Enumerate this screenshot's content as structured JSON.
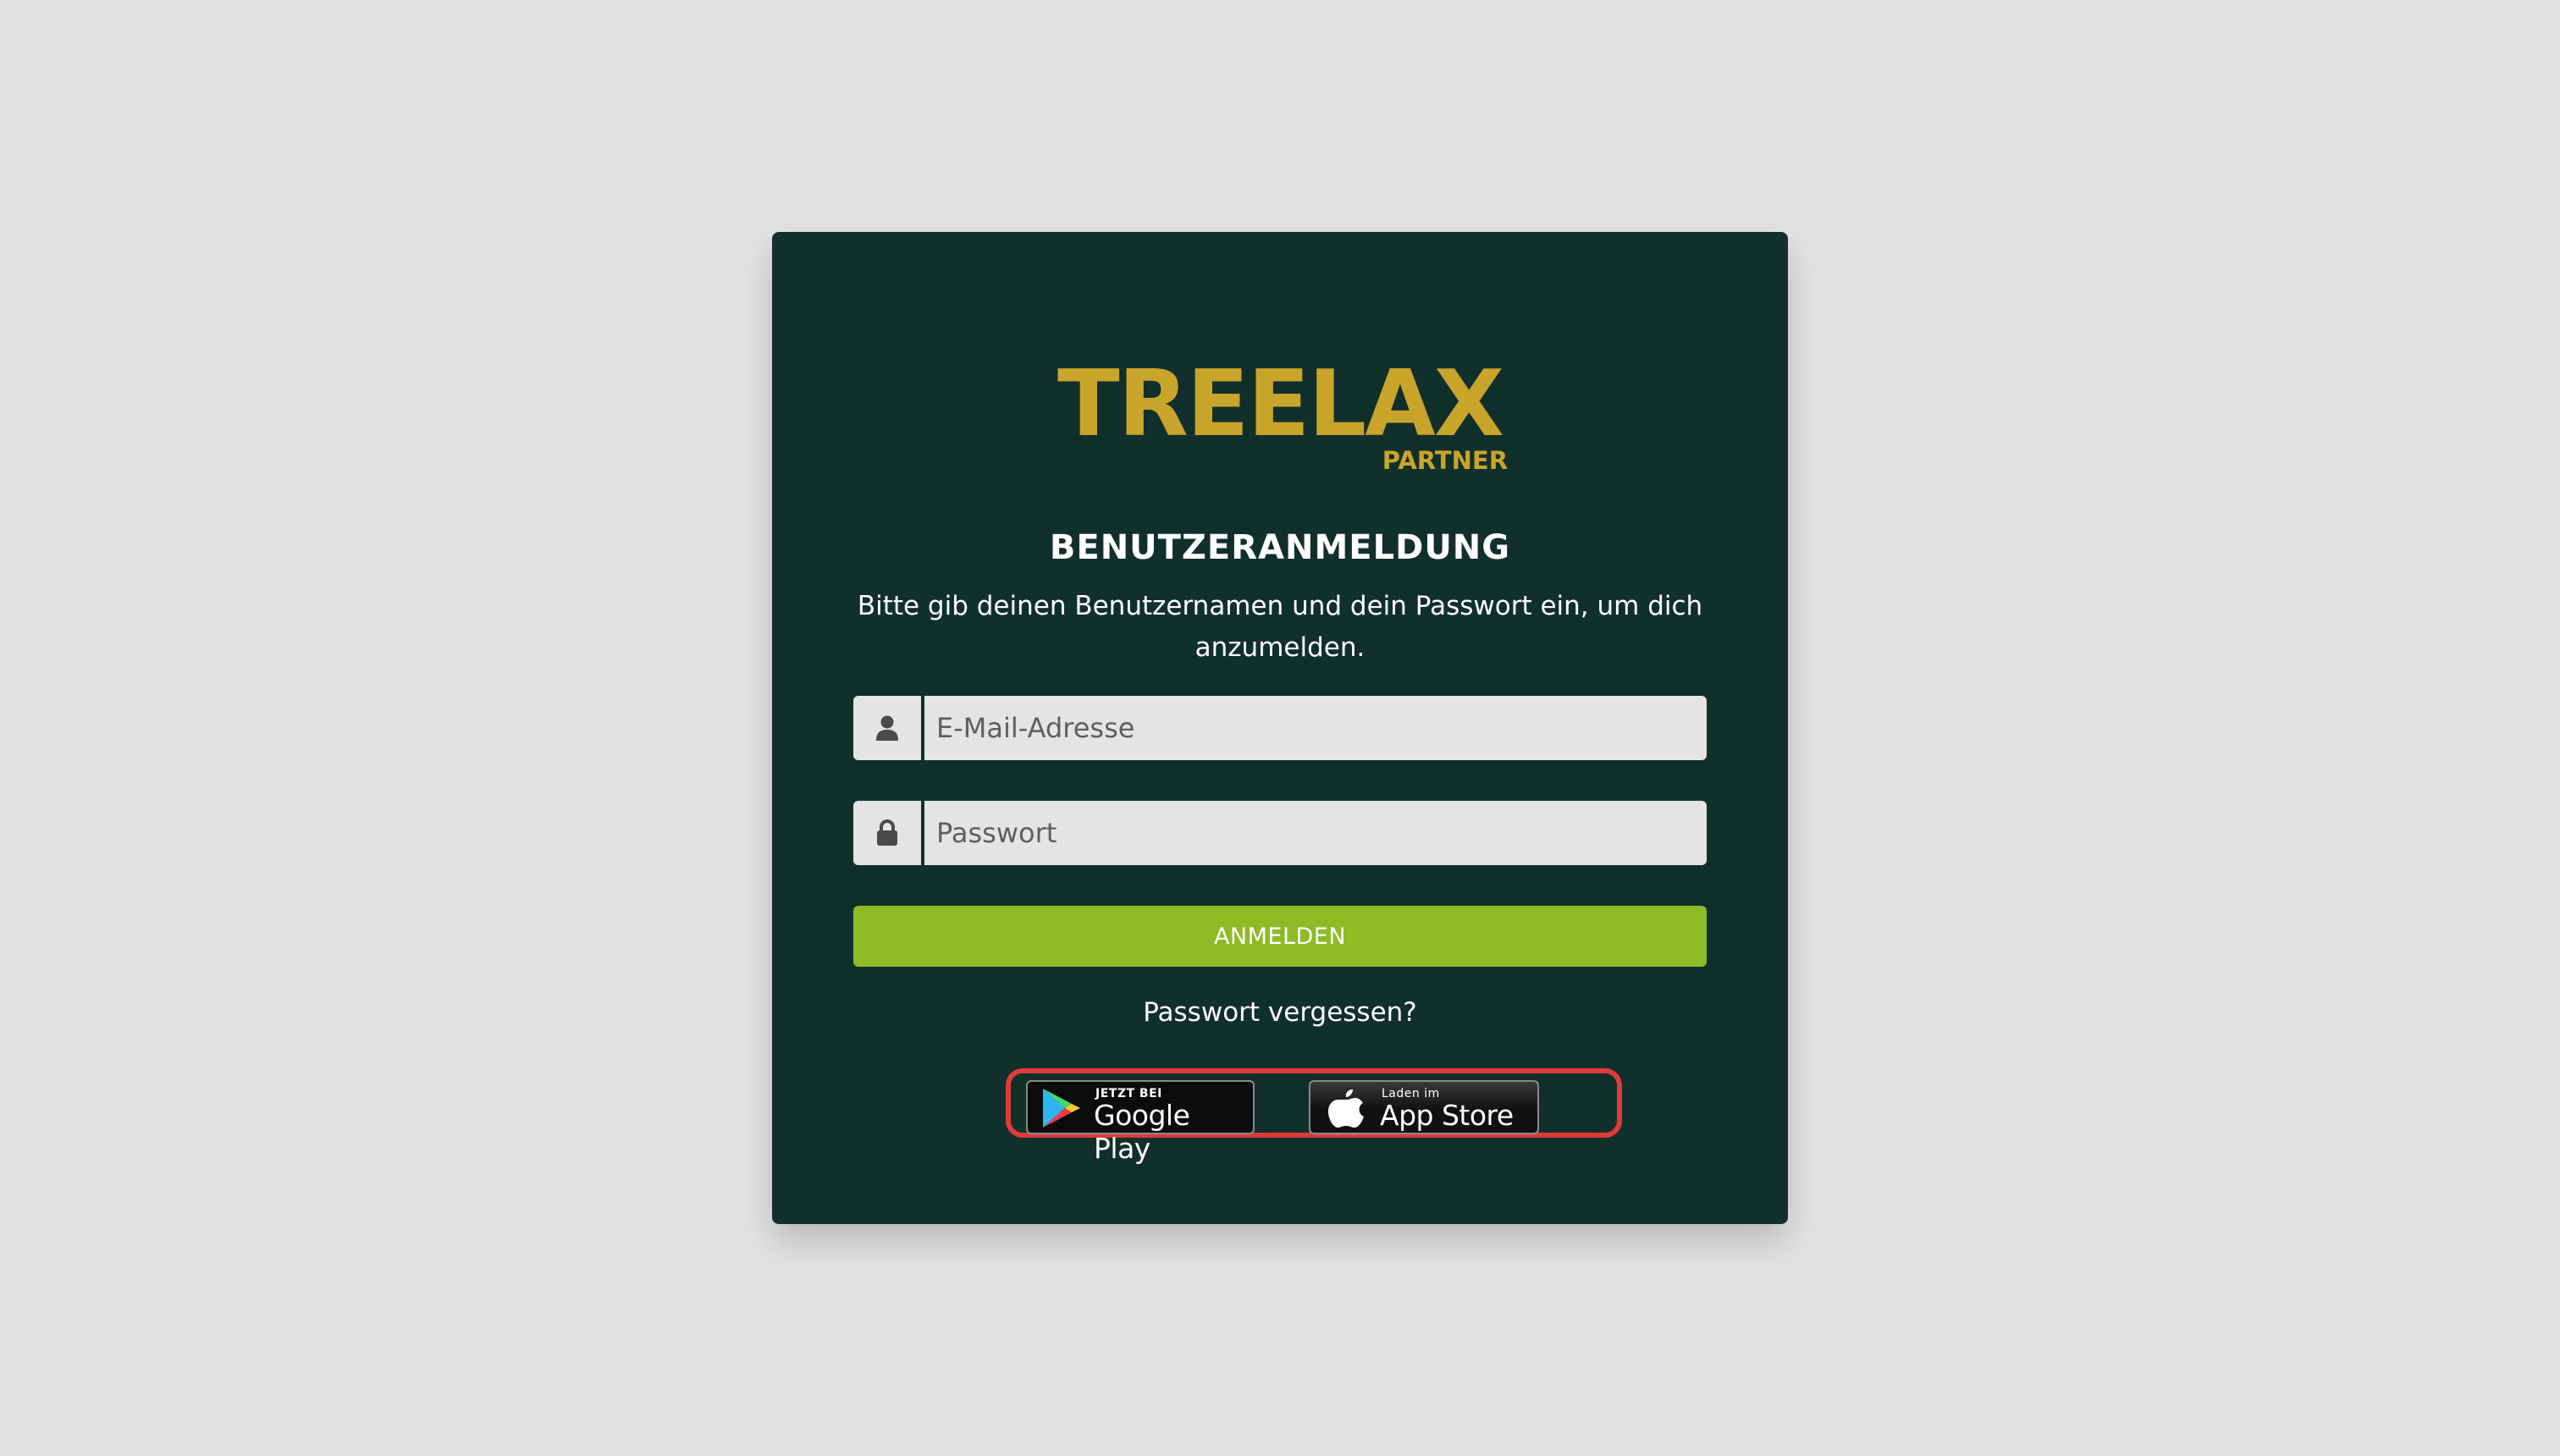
{
  "logo": {
    "main": "TREELAX",
    "sub": "PARTNER"
  },
  "login": {
    "heading": "BENUTZERANMELDUNG",
    "instructions": "Bitte gib deinen Benutzernamen und dein Passwort ein, um dich anzumelden.",
    "email_placeholder": "E-Mail-Adresse",
    "email_value": "",
    "password_placeholder": "Passwort",
    "password_value": "",
    "submit_label": "ANMELDEN",
    "forgot_label": "Passwort vergessen?"
  },
  "stores": {
    "google_small": "JETZT BEI",
    "google_big": "Google Play",
    "apple_small": "Laden im",
    "apple_big": "App Store",
    "highlight_color": "#e03a3a"
  },
  "colors": {
    "background": "#e2e2e2",
    "card": "#11302b",
    "logo": "#c9a42a",
    "button": "#8dbb26"
  }
}
